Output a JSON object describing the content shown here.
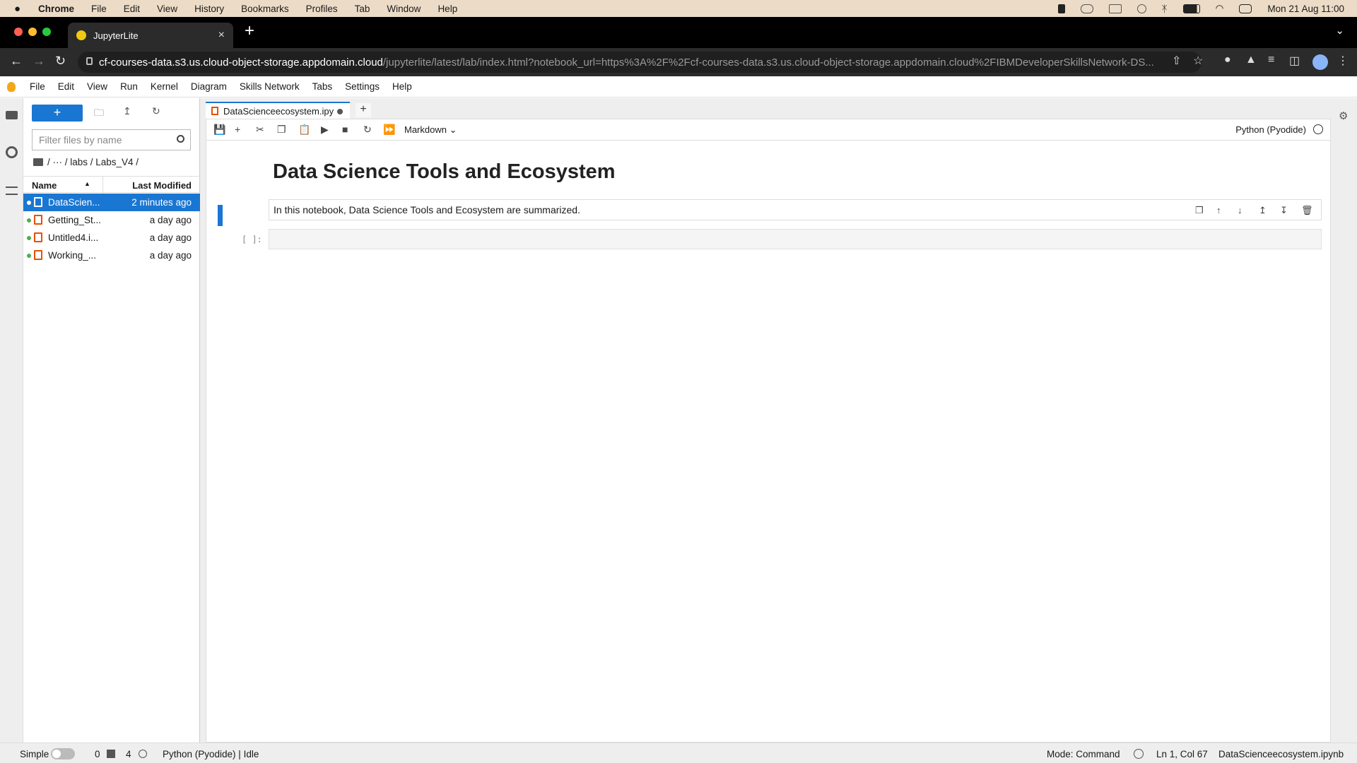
{
  "mac_menu": {
    "apple": "",
    "items": [
      "Chrome",
      "File",
      "Edit",
      "View",
      "History",
      "Bookmarks",
      "Profiles",
      "Tab",
      "Window",
      "Help"
    ],
    "datetime": "Mon 21 Aug  11:00"
  },
  "chrome": {
    "tab_title": "JupyterLite",
    "tab_close": "×",
    "new_tab": "+",
    "url_host": "cf-courses-data.s3.us.cloud-object-storage.appdomain.cloud",
    "url_rest": "/jupyterlite/latest/lab/index.html?notebook_url=https%3A%2F%2Fcf-courses-data.s3.us.cloud-object-storage.appdomain.cloud%2FIBMDeveloperSkillsNetwork-DS..."
  },
  "jupyter_menu": [
    "File",
    "Edit",
    "View",
    "Run",
    "Kernel",
    "Diagram",
    "Skills Network",
    "Tabs",
    "Settings",
    "Help"
  ],
  "file_browser": {
    "new_label": "+",
    "filter_placeholder": "Filter files by name",
    "breadcrumb": "/  ···  / labs / Labs_V4 /",
    "col_name": "Name",
    "col_modified": "Last Modified",
    "files": [
      {
        "name": "DataScien...",
        "modified": "2 minutes ago"
      },
      {
        "name": "Getting_St...",
        "modified": "a day ago"
      },
      {
        "name": "Untitled4.i...",
        "modified": "a day ago"
      },
      {
        "name": "Working_...",
        "modified": "a day ago"
      }
    ]
  },
  "notebook": {
    "tab_title": "DataScienceecosystem.ipy",
    "add_tab": "+",
    "cell_type": "Markdown",
    "kernel_name": "Python (Pyodide)",
    "heading": "Data Science Tools and Ecosystem",
    "md_text": "In this notebook, Data Science Tools and Ecosystem are summarized.",
    "prompt": "[ ]:"
  },
  "status": {
    "mode_toggle_label": "Simple",
    "terminals": "0",
    "kernels": "4",
    "kernel_status": "Python (Pyodide) | Idle",
    "mode": "Mode: Command",
    "cursor": "Ln 1, Col 67",
    "filename": "DataScienceecosystem.ipynb"
  },
  "colors": {
    "accent": "#1976d2",
    "notebook_icon": "#e65100",
    "menu_bar": "#ecdcc7"
  }
}
